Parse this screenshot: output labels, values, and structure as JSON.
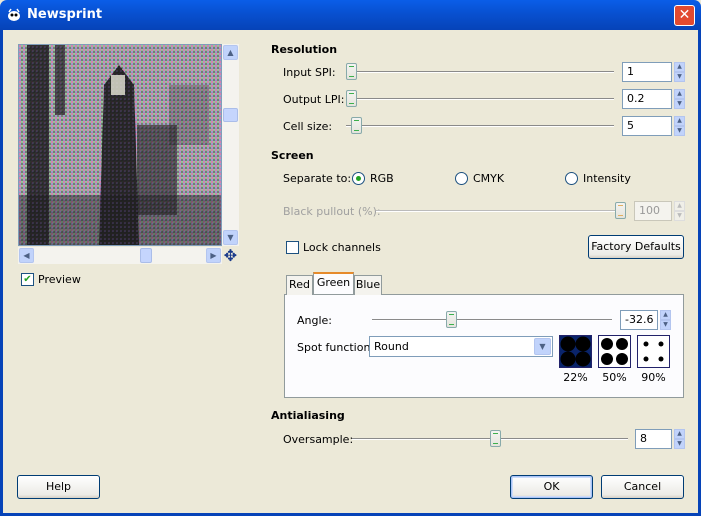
{
  "window": {
    "title": "Newsprint"
  },
  "preview": {
    "checkbox_label": "Preview",
    "checked": true
  },
  "resolution": {
    "header": "Resolution",
    "input_spi": {
      "label": "Input SPI:",
      "value": "1"
    },
    "output_lpi": {
      "label": "Output LPI:",
      "value": "0.2"
    },
    "cell_size": {
      "label": "Cell size:",
      "value": "5"
    }
  },
  "screen": {
    "header": "Screen",
    "separate_to_label": "Separate to:",
    "options": [
      "RGB",
      "CMYK",
      "Intensity"
    ],
    "selected": "RGB",
    "black_pullout": {
      "label": "Black pullout (%):",
      "value": "100",
      "enabled": false
    },
    "lock_channels": {
      "label": "Lock channels",
      "checked": false
    },
    "factory_defaults": "Factory Defaults",
    "tabs": [
      "Red",
      "Green",
      "Blue"
    ],
    "active_tab": "Green",
    "angle": {
      "label": "Angle:",
      "value": "-32.6"
    },
    "spot_function": {
      "label": "Spot function:",
      "value": "Round"
    },
    "spot_previews": [
      "22%",
      "50%",
      "90%"
    ]
  },
  "antialiasing": {
    "header": "Antialiasing",
    "oversample": {
      "label": "Oversample:",
      "value": "8"
    }
  },
  "buttons": {
    "help": "Help",
    "ok": "OK",
    "cancel": "Cancel"
  },
  "colors": {
    "titlebar": "#0a5ee8",
    "close": "#e24a30",
    "dialog_bg": "#ece9d8",
    "active_tab_accent": "#e68b2c"
  }
}
